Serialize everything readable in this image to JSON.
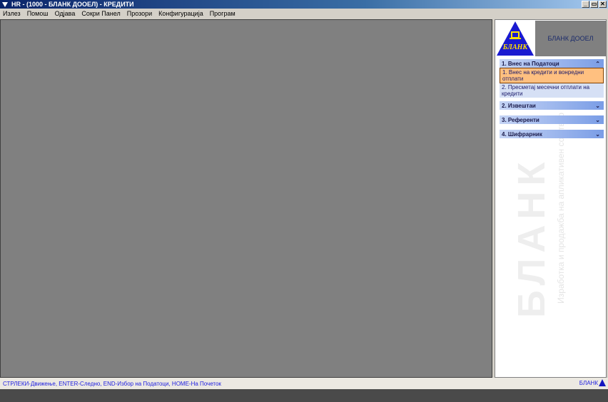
{
  "window": {
    "title": "HR -  (1000 - БЛАНК ДООЕЛ) - КРЕДИТИ",
    "minimize": "_",
    "restore": "▭",
    "close": "✕"
  },
  "menu": [
    "Излез",
    "Помош",
    "Одјава",
    "Сокри Панел",
    "Прозори",
    "Конфигурација",
    "Програм"
  ],
  "panel": {
    "company": "БЛАНК ДООЕЛ",
    "logo_text": "БЛАНК",
    "watermark": "БЛАНК",
    "watermark_sub": "Изработка и продажба на апликативен софтвер",
    "groups": [
      {
        "label": "1. Внес на Податоци",
        "icon": "chevron-up-double",
        "items": [
          "1. Внес на кредити и вонредни отплати",
          "2.  Пресметај месечни отплати на кредити"
        ]
      },
      {
        "label": "2. Извештаи",
        "icon": "chevron-down-double"
      },
      {
        "label": "3. Референти",
        "icon": "chevron-down-double"
      },
      {
        "label": "4. Шифрарник",
        "icon": "chevron-down-double"
      }
    ]
  },
  "status": {
    "hint": "СТРЛЕКИ-Движење, ENTER-Следно,  END-Избор на Податоци, HOME-На Почеток",
    "brand": "БЛАНК"
  }
}
